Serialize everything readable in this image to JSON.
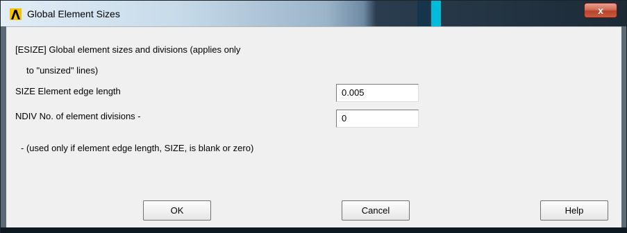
{
  "window": {
    "title": "Global Element Sizes",
    "close_label": "x"
  },
  "form": {
    "header_line1": "[ESIZE]  Global element sizes and divisions (applies only",
    "header_line2": "to \"unsized\" lines)",
    "size_label": "SIZE  Element edge length",
    "size_value": "0.005",
    "ndiv_label": "NDIV  No. of element divisions -",
    "ndiv_value": "0",
    "note": "- (used only if element edge length, SIZE, is blank or zero)"
  },
  "buttons": {
    "ok": "OK",
    "cancel": "Cancel",
    "help": "Help"
  },
  "colors": {
    "icon_yellow": "#f5c300",
    "icon_black": "#000000",
    "close_red": "#c8432b"
  }
}
